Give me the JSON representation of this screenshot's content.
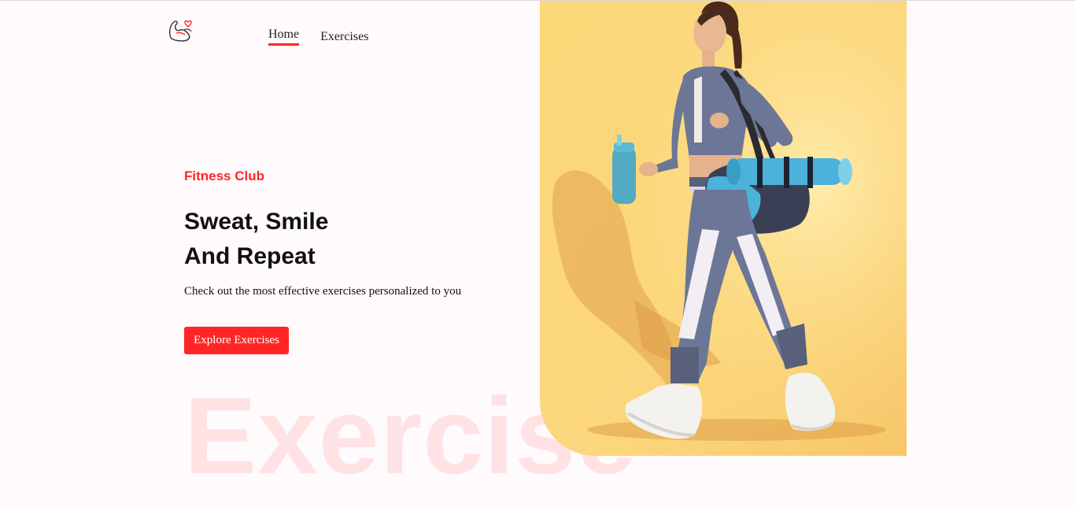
{
  "nav": {
    "logo_icon": "flexed-arm-heart-icon",
    "items": [
      {
        "label": "Home",
        "active": true
      },
      {
        "label": "Exercises",
        "active": false
      }
    ],
    "active_color": "#ff2625"
  },
  "hero": {
    "subtitle": "Fitness Club",
    "title_line1": "Sweat, Smile",
    "title_line2": "And Repeat",
    "description": "Check out the most effective exercises personalized to you",
    "cta_label": "Explore Exercises",
    "watermark": "Exercise",
    "accent_color": "#ff2625",
    "image_icon": "woman-walking-with-gym-bag-image"
  }
}
